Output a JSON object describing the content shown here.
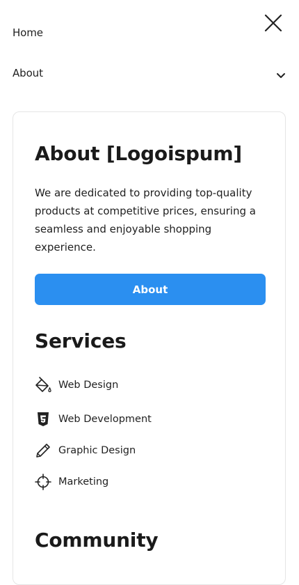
{
  "nav": {
    "items": [
      {
        "label": "Home"
      },
      {
        "label": "About"
      }
    ],
    "close_icon": "close-icon",
    "expand_icon": "chevron-down-icon"
  },
  "about": {
    "title": "About [Logoispum]",
    "description": "We are dedicated to providing top-quality products at competitive prices, ensuring a seamless and enjoyable shopping experience.",
    "button_label": "About",
    "button_color": "#2b8ff0"
  },
  "services": {
    "title": "Services",
    "items": [
      {
        "label": "Web Design",
        "icon": "paint-bucket-icon"
      },
      {
        "label": "Web Development",
        "icon": "html5-icon"
      },
      {
        "label": "Graphic Design",
        "icon": "pencil-icon"
      },
      {
        "label": "Marketing",
        "icon": "crosshair-icon"
      }
    ]
  },
  "community": {
    "title": "Community"
  }
}
